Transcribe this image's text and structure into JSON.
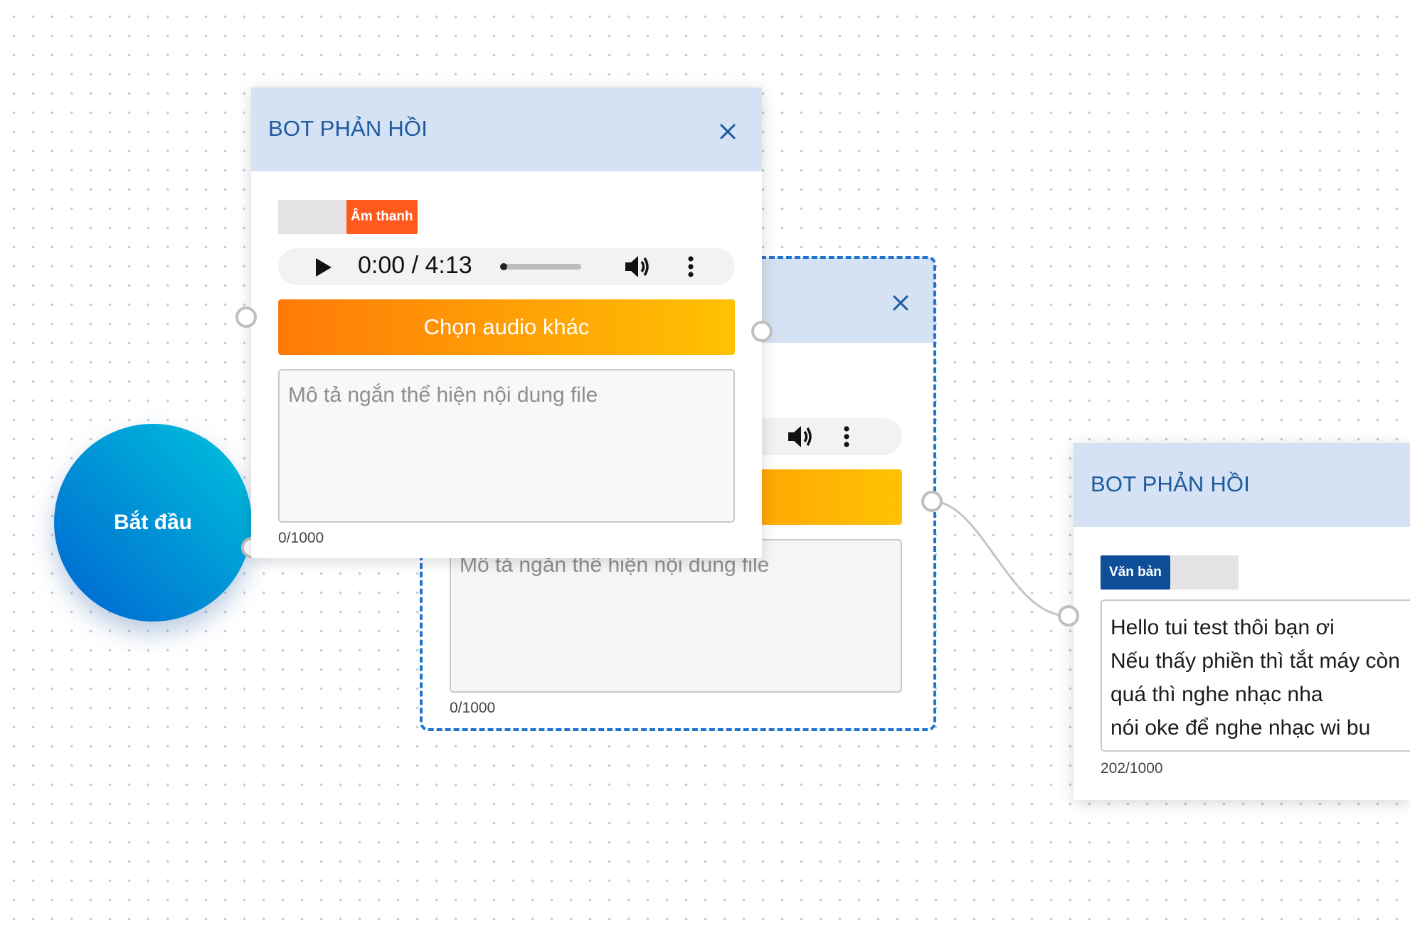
{
  "start_node": {
    "label": "Bắt đầu"
  },
  "back_card": {
    "close_glyph": "×",
    "choose_audio_label": "",
    "description_placeholder": "Mô tả ngắn thể hiện nội dung file",
    "char_count": "0/1000"
  },
  "front_card": {
    "title": "BOT PHẢN HỒI",
    "close_glyph": "×",
    "type_toggle": {
      "active": "Âm thanh"
    },
    "audio_player": {
      "time": "0:00 / 4:13",
      "progress": 0
    },
    "choose_audio_label": "Chọn audio khác",
    "description_placeholder": "Mô tả ngắn thể hiện nội dung file",
    "char_count": "0/1000"
  },
  "right_card": {
    "title": "BOT PHẢN HỒI",
    "type_toggle": {
      "active": "Văn bản"
    },
    "message_lines": [
      "Hello tui test thôi bạn ơi",
      "Nếu thấy phiền thì tắt máy còn",
      "quá thì nghe nhạc nha",
      "nói oke để nghe nhạc wi bu"
    ],
    "char_count": "202/1000"
  },
  "colors": {
    "header_bg": "#d5e2f3",
    "title": "#1d5aa0",
    "audio_toggle": "#ff5a1e",
    "text_toggle": "#0f4f9a",
    "button_gradient_start": "#ff7a08",
    "button_gradient_end": "#ffc202",
    "selection_border": "#1f74d1",
    "start_gradient_start": "#0063d1",
    "start_gradient_end": "#00c4dc"
  },
  "icons": [
    "play-icon",
    "volume-icon",
    "more-vertical-icon",
    "close-icon"
  ]
}
